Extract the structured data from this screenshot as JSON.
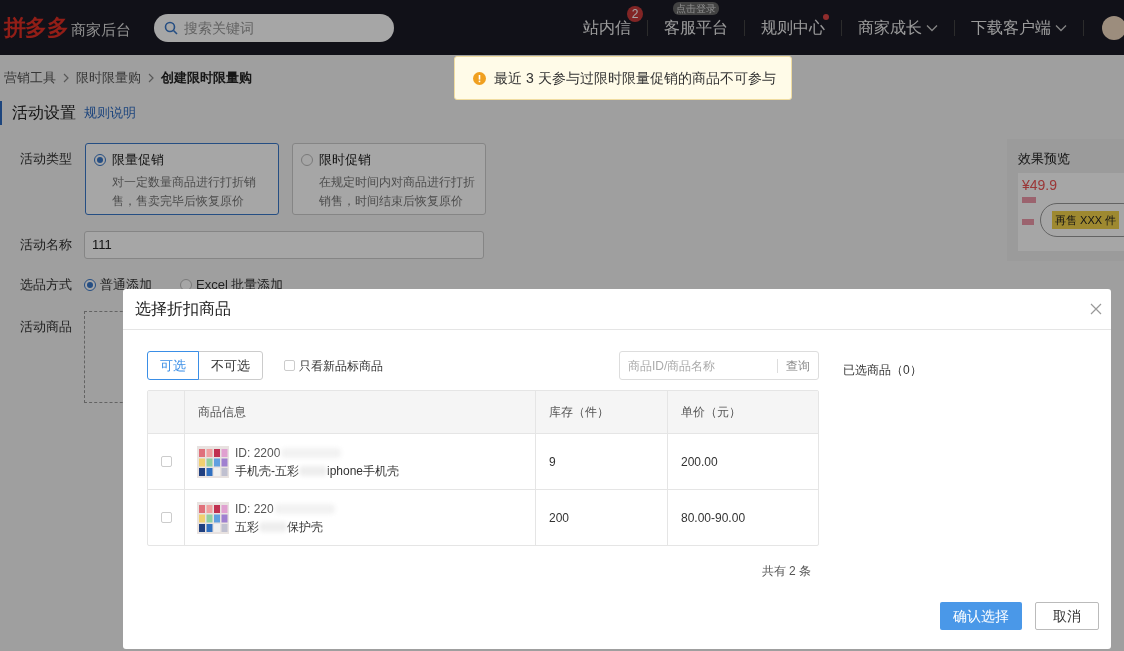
{
  "header": {
    "logo": "拼多多",
    "subtitle": "商家后台",
    "search": {
      "placeholder": "搜索关键词"
    },
    "nav": [
      {
        "label": "站内信",
        "badge": "2"
      },
      {
        "label": "客服平台",
        "tip": "点击登录"
      },
      {
        "label": "规则中心",
        "dot": true
      },
      {
        "label": "商家成长",
        "dropdown": true
      },
      {
        "label": "下载客户端",
        "dropdown": true
      }
    ]
  },
  "breadcrumb": [
    "营销工具",
    "限时限量购",
    "创建限时限量购"
  ],
  "toast": {
    "text": "最近 3 天参与过限时限量促销的商品不可参与"
  },
  "section": {
    "title": "活动设置",
    "link": "规则说明"
  },
  "form": {
    "type_label": "活动类型",
    "types": [
      {
        "title": "限量促销",
        "desc": "对一定数量商品进行打折销售，售卖完毕后恢复原价",
        "selected": true
      },
      {
        "title": "限时促销",
        "desc": "在规定时间内对商品进行打折销售，时间结束后恢复原价",
        "selected": false
      }
    ],
    "name_label": "活动名称",
    "name_value": "111",
    "method_label": "选品方式",
    "methods": [
      {
        "label": "普通添加",
        "selected": true
      },
      {
        "label": "Excel 批量添加",
        "selected": false
      }
    ],
    "goods_label": "活动商品"
  },
  "preview": {
    "title": "效果预览",
    "price": "¥49.9",
    "bubble": "再售 XXX 件"
  },
  "dialog": {
    "title": "选择折扣商品",
    "tabs": [
      {
        "label": "可选",
        "selected": true
      },
      {
        "label": "不可选",
        "selected": false
      }
    ],
    "filter": {
      "label": "只看新品标商品",
      "checked": false
    },
    "search": {
      "placeholder": "商品ID/商品名称",
      "button": "查询"
    },
    "columns": [
      "商品信息",
      "库存（件）",
      "单价（元）"
    ],
    "rows": [
      {
        "checked": false,
        "id": "ID: 2200",
        "name_start": "手机壳-五彩",
        "name_end": "iphone手机壳",
        "stock": "9",
        "price": "200.00"
      },
      {
        "checked": false,
        "id": "ID: 220",
        "name_start": "五彩",
        "name_end": "保护壳",
        "stock": "200",
        "price": "80.00-90.00"
      }
    ],
    "total": "共有 2 条",
    "selected_title": "已选商品（0）",
    "confirm": "确认选择",
    "cancel": "取消"
  }
}
